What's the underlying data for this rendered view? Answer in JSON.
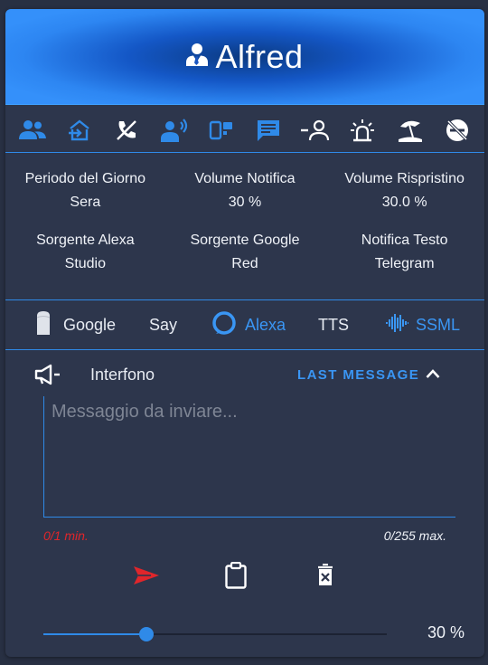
{
  "header": {
    "title": "Alfred"
  },
  "iconbar": [
    {
      "icon": "people-icon"
    },
    {
      "icon": "home-export-icon"
    },
    {
      "icon": "phone-off-icon"
    },
    {
      "icon": "account-voice-icon"
    },
    {
      "icon": "devices-icon"
    },
    {
      "icon": "message-text-icon"
    },
    {
      "icon": "account-minus-icon"
    },
    {
      "icon": "alarm-light-icon"
    },
    {
      "icon": "beach-icon"
    },
    {
      "icon": "do-not-disturb-icon"
    }
  ],
  "info": {
    "rows": [
      [
        {
          "label": "Periodo del Giorno",
          "value": "Sera"
        },
        {
          "label": "Volume Notifica",
          "value": "30 %"
        },
        {
          "label": "Volume Rispristino",
          "value": "30.0 %"
        }
      ],
      [
        {
          "label": "Sorgente Alexa",
          "value": "Studio"
        },
        {
          "label": "Sorgente Google",
          "value": "Red"
        },
        {
          "label": "Notifica Testo",
          "value": "Telegram"
        }
      ]
    ]
  },
  "modes": [
    {
      "label": "Google",
      "icon": "google-home-icon",
      "active": false
    },
    {
      "label": "Say",
      "active": false
    },
    {
      "label": "Alexa",
      "icon": "alexa-icon",
      "active": true
    },
    {
      "label": "TTS",
      "active": false
    },
    {
      "label": "SSML",
      "icon": "waveform-icon",
      "active": true
    }
  ],
  "section": {
    "title": "Interfono",
    "last_message_label": "LAST MESSAGE",
    "icon": "megaphone-icon"
  },
  "message": {
    "placeholder": "Messaggio da inviare...",
    "value": "",
    "min_counter": "0/1 min.",
    "max_counter": "0/255 max."
  },
  "actions": [
    {
      "name": "send-button",
      "icon": "send-icon"
    },
    {
      "name": "paste-button",
      "icon": "clipboard-icon"
    },
    {
      "name": "delete-button",
      "icon": "trash-icon"
    }
  ],
  "volume": {
    "value": 30,
    "text": "30 %"
  },
  "colors": {
    "accent": "#2f8ae8",
    "active_text": "#3a96f4",
    "error": "#e0262b",
    "card": "#2d364c",
    "background": "#283043"
  }
}
